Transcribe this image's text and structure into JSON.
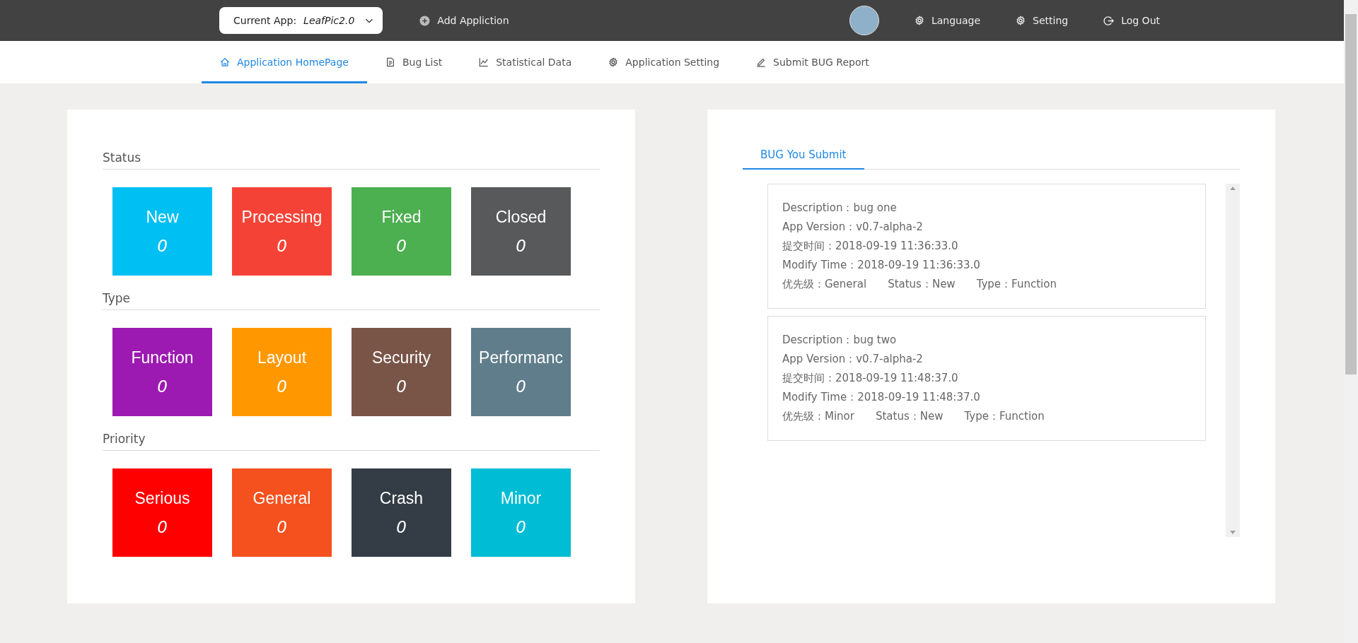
{
  "header": {
    "current_app_label": "Current App:",
    "current_app": "LeafPic2.0",
    "add_app": "Add Appliction",
    "menu": [
      {
        "label": "Language"
      },
      {
        "label": "Setting"
      },
      {
        "label": "Log Out"
      }
    ]
  },
  "tabs": [
    {
      "label": "Application HomePage",
      "selected": true
    },
    {
      "label": "Bug List",
      "selected": false
    },
    {
      "label": "Statistical Data",
      "selected": false
    },
    {
      "label": "Application Setting",
      "selected": false
    },
    {
      "label": "Submit BUG Report",
      "selected": false
    }
  ],
  "sections": [
    {
      "title": "Status",
      "tiles": [
        {
          "label": "New",
          "count": "0",
          "color": "#00bff3"
        },
        {
          "label": "Processing",
          "count": "0",
          "color": "#f44336"
        },
        {
          "label": "Fixed",
          "count": "0",
          "color": "#4caf50"
        },
        {
          "label": "Closed",
          "count": "0",
          "color": "#58595b"
        }
      ]
    },
    {
      "title": "Type",
      "tiles": [
        {
          "label": "Function",
          "count": "0",
          "color": "#9c1ab1"
        },
        {
          "label": "Layout",
          "count": "0",
          "color": "#ff9800"
        },
        {
          "label": "Security",
          "count": "0",
          "color": "#795548"
        },
        {
          "label": "Performanc",
          "count": "0",
          "color": "#607d8b"
        }
      ]
    },
    {
      "title": "Priority",
      "tiles": [
        {
          "label": "Serious",
          "count": "0",
          "color": "#ff0000"
        },
        {
          "label": "General",
          "count": "0",
          "color": "#f4511e"
        },
        {
          "label": "Crash",
          "count": "0",
          "color": "#343d46"
        },
        {
          "label": "Minor",
          "count": "0",
          "color": "#00bcd4"
        }
      ]
    }
  ],
  "bug_tab": {
    "label": "BUG You Submit",
    "selected": true
  },
  "bugs": [
    {
      "lines": [
        [
          "Description：bug one"
        ],
        [
          "App Version：v0.7-alpha-2"
        ],
        [
          "提交时间：2018-09-19 11:36:33.0"
        ],
        [
          "Modify Time：2018-09-19 11:36:33.0"
        ],
        [
          "优先级：General",
          "Status：New",
          "Type：Function"
        ]
      ]
    },
    {
      "lines": [
        [
          "Description：bug two"
        ],
        [
          "App Version：v0.7-alpha-2"
        ],
        [
          "提交时间：2018-09-19 11:48:37.0"
        ],
        [
          "Modify Time：2018-09-19 11:48:37.0"
        ],
        [
          "优先级：Minor",
          "Status：New",
          "Type：Function"
        ]
      ]
    }
  ]
}
